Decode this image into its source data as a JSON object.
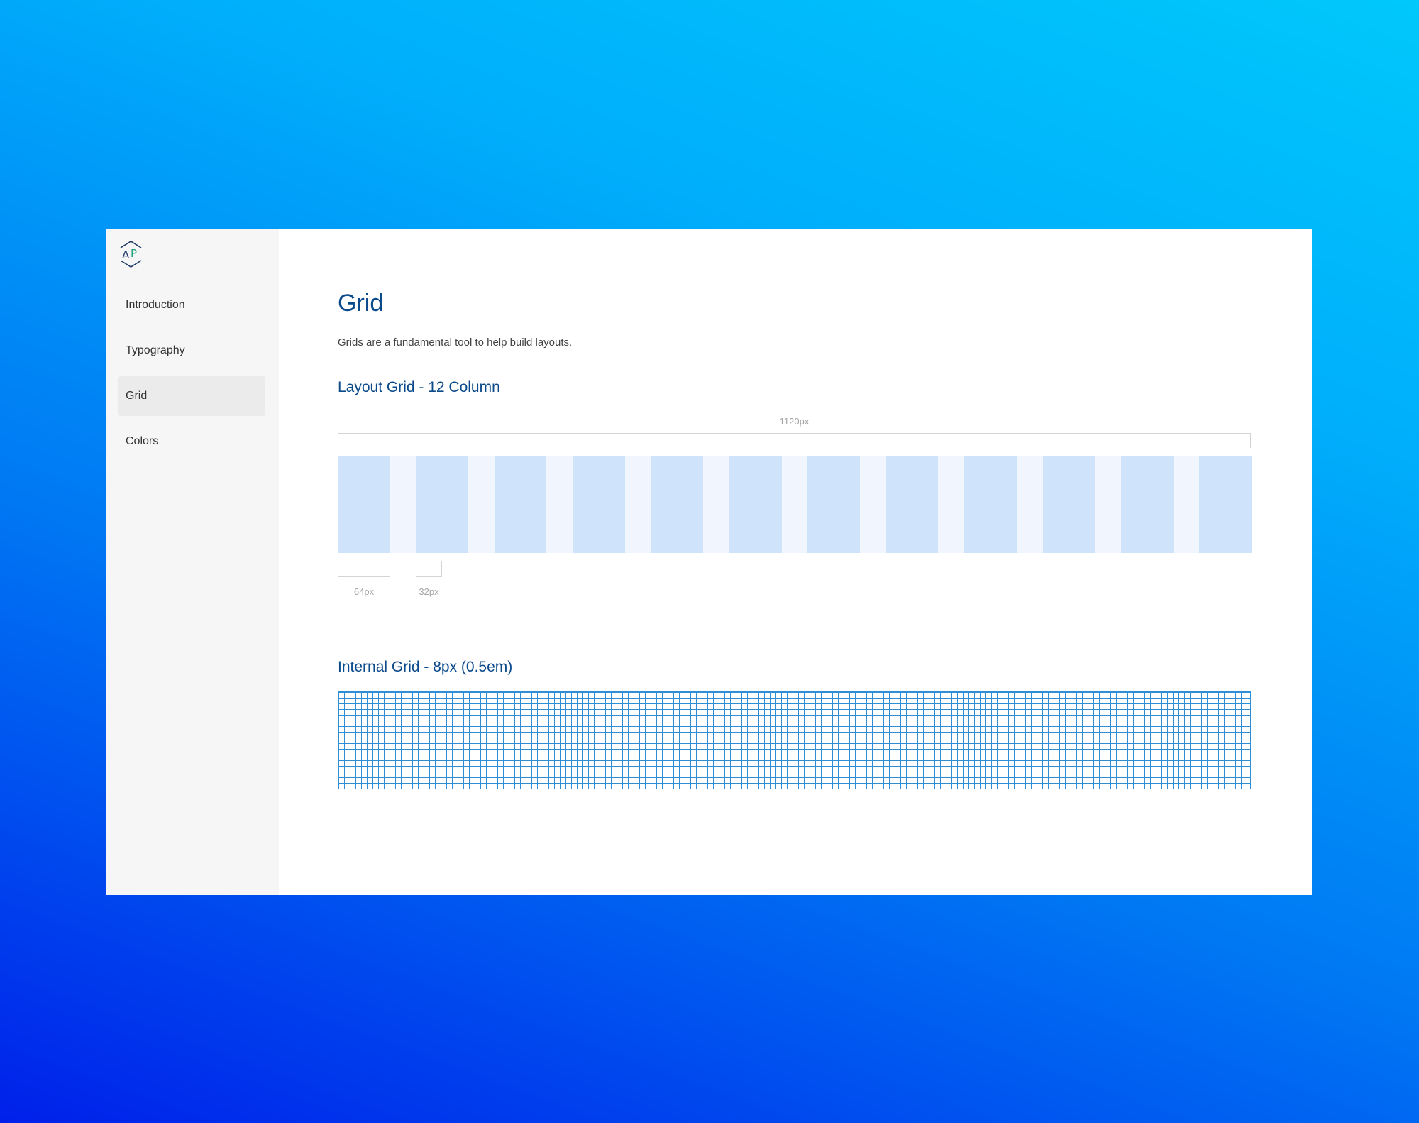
{
  "sidebar": {
    "logo": {
      "text": "AP",
      "icon": "ap-hexagon-logo-icon",
      "colors": {
        "outline": "#1f3b66",
        "A": "#1f3b66",
        "P": "#1aa17a"
      }
    },
    "items": [
      {
        "label": "Introduction",
        "active": false
      },
      {
        "label": "Typography",
        "active": false
      },
      {
        "label": "Grid",
        "active": true
      },
      {
        "label": "Colors",
        "active": false
      }
    ]
  },
  "main": {
    "title": "Grid",
    "description": "Grids are a fundamental tool to help build layouts.",
    "layout_grid": {
      "title": "Layout Grid - 12 Column",
      "total_width_label": "1120px",
      "column_width_label": "64px",
      "gutter_width_label": "32px",
      "column_count": 12,
      "column_color": "#cfe3fb",
      "gutter_color": "#f1f6fe"
    },
    "internal_grid": {
      "title": "Internal Grid - 8px (0.5em)",
      "line_color": "#2d8ed6"
    }
  },
  "colors": {
    "heading": "#0b4a8a",
    "sidebar_bg": "#f6f6f6",
    "active_item_bg": "#ebebeb",
    "background_gradient": [
      "#00c8fb",
      "#00aefb",
      "#0077f3",
      "#0020ea"
    ]
  }
}
